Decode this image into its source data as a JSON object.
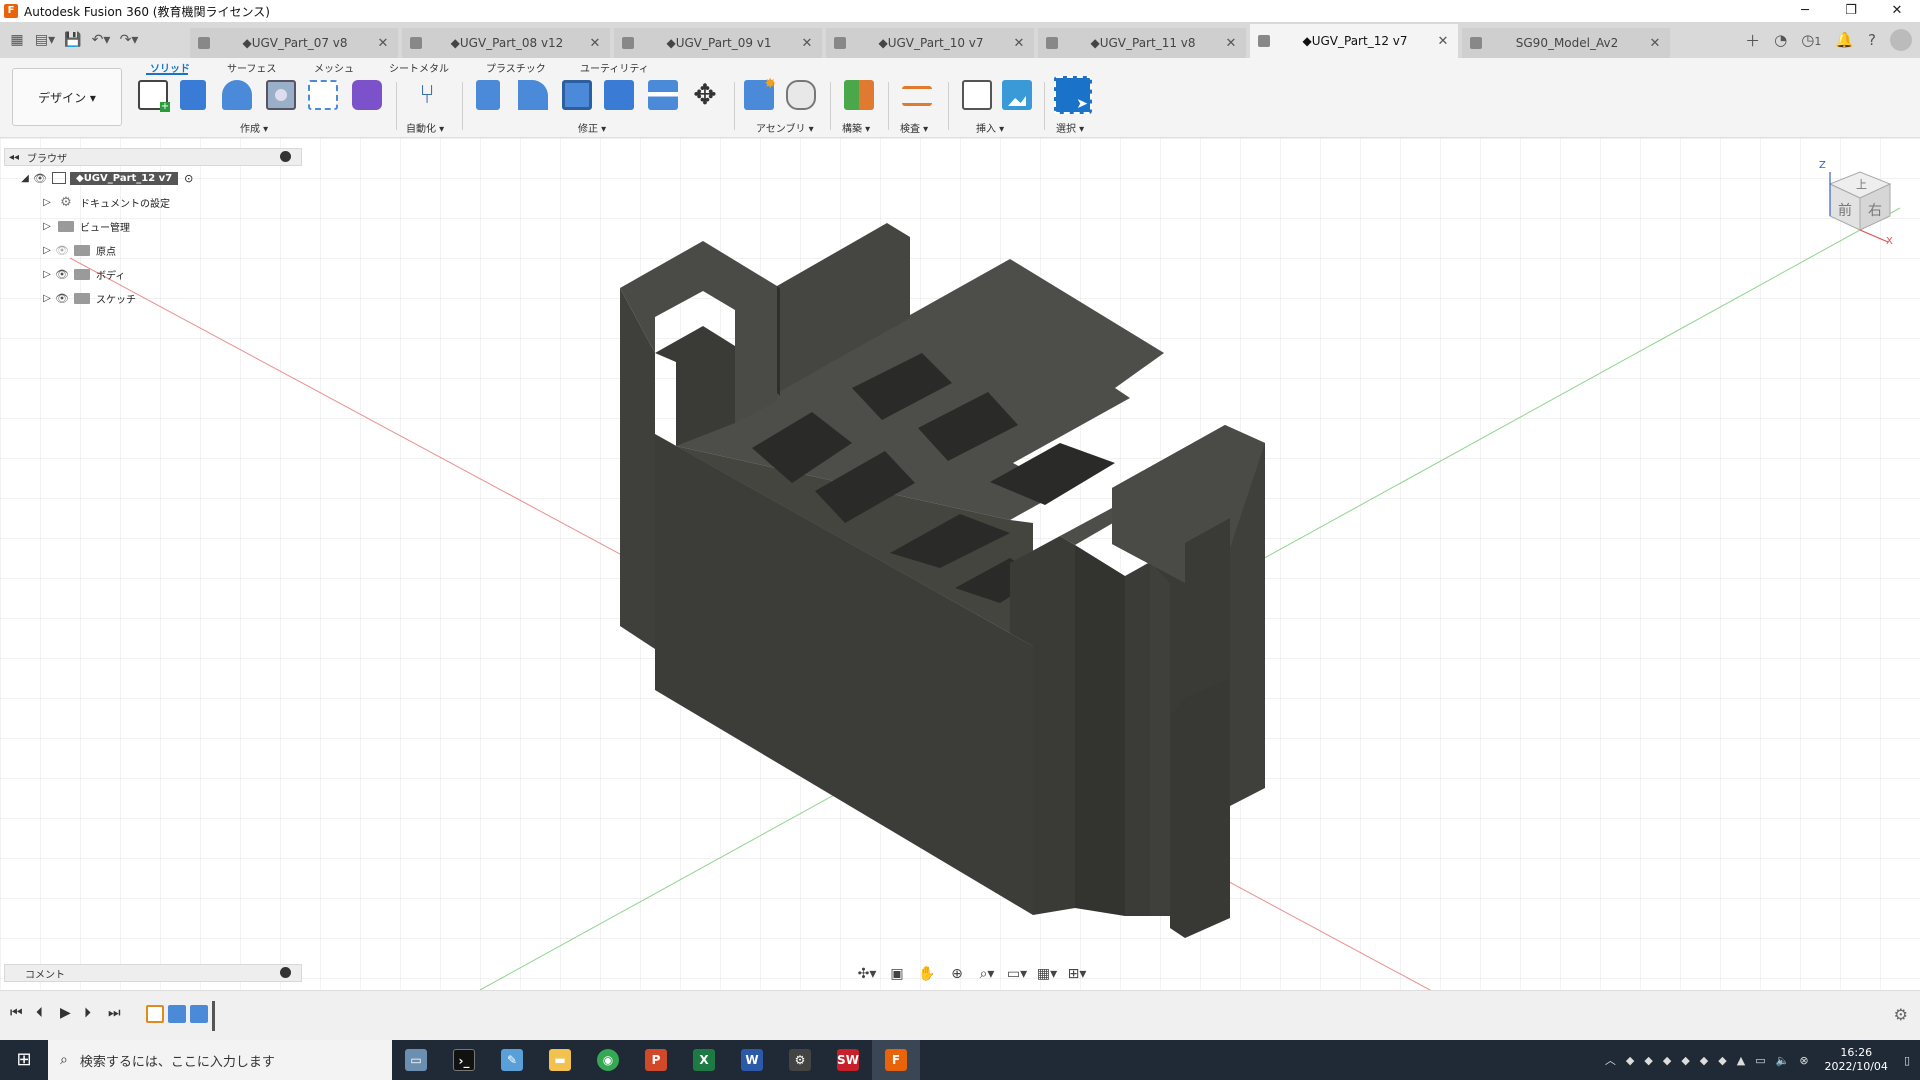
{
  "window": {
    "title": "Autodesk Fusion 360 (教育機関ライセンス)",
    "app_icon": "F"
  },
  "doc_tabs": [
    {
      "label": "◆UGV_Part_07 v8",
      "active": false
    },
    {
      "label": "◆UGV_Part_08 v12",
      "active": false
    },
    {
      "label": "◆UGV_Part_09 v1",
      "active": false
    },
    {
      "label": "◆UGV_Part_10 v7",
      "active": false
    },
    {
      "label": "◆UGV_Part_11 v8",
      "active": false
    },
    {
      "label": "◆UGV_Part_12 v7",
      "active": true
    },
    {
      "label": "SG90_Model_Av2",
      "active": false
    }
  ],
  "tabbar_right": {
    "job_count": "1"
  },
  "toolbar": {
    "workspace": "デザイン ▾",
    "modes": [
      "ソリッド",
      "サーフェス",
      "メッシュ",
      "シートメタル",
      "プラスチック",
      "ユーティリティ"
    ],
    "groups": [
      "作成 ▾",
      "自動化 ▾",
      "修正 ▾",
      "アセンブリ ▾",
      "構築 ▾",
      "検査 ▾",
      "挿入 ▾",
      "選択 ▾"
    ]
  },
  "browser": {
    "title": "ブラウザ",
    "root": "◆UGV_Part_12 v7",
    "items": [
      "ドキュメントの設定",
      "ビュー管理",
      "原点",
      "ボディ",
      "スケッチ"
    ]
  },
  "viewcube": {
    "top": "上",
    "front": "前",
    "right": "右",
    "axis_z": "Z",
    "axis_x": "X"
  },
  "comments": {
    "title": "コメント"
  },
  "taskbar": {
    "search_placeholder": "検索するには、ここに入力します",
    "time": "16:26",
    "date": "2022/10/04"
  },
  "colors": {
    "accent": "#1a73c9",
    "model_top": "#4a4a46",
    "model_left": "#3a3a37",
    "model_right": "#30302d",
    "x_axis": "#e06060",
    "y_axis": "#5fc45f"
  }
}
